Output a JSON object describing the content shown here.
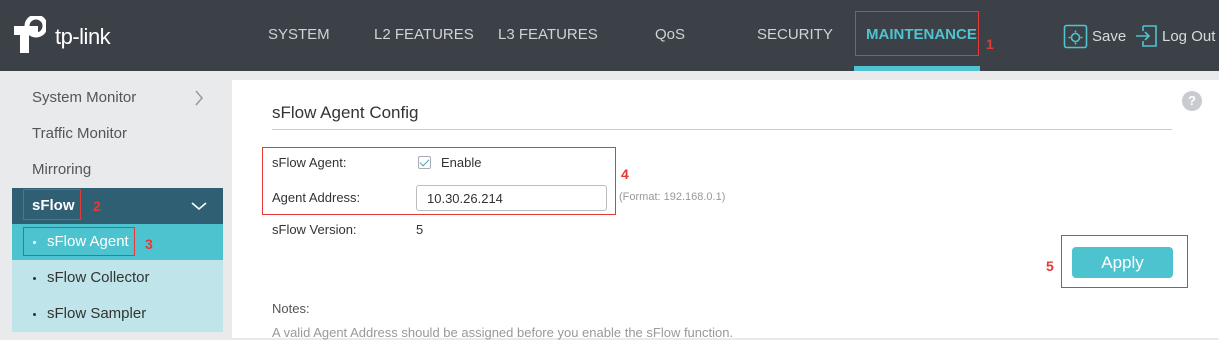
{
  "brand": {
    "logo_text": "tp-link",
    "accent": "#4fc3cf"
  },
  "nav": {
    "items": [
      {
        "label": "SYSTEM"
      },
      {
        "label": "L2 FEATURES"
      },
      {
        "label": "L3 FEATURES"
      },
      {
        "label": "QoS"
      },
      {
        "label": "SECURITY"
      },
      {
        "label": "MAINTENANCE",
        "active": true
      }
    ]
  },
  "toolbar": {
    "save_label": "Save",
    "save_icon": "gear-save-icon",
    "logout_label": "Log Out",
    "logout_icon": "logout-icon"
  },
  "sidebar": {
    "items": [
      {
        "label": "System Monitor",
        "icon": "chevron-right-icon"
      },
      {
        "label": "Traffic Monitor"
      },
      {
        "label": "Mirroring"
      },
      {
        "label": "sFlow",
        "active": true,
        "icon": "chevron-down-icon"
      }
    ],
    "sub_items": [
      {
        "label": "sFlow Agent",
        "active": true
      },
      {
        "label": "sFlow Collector"
      },
      {
        "label": "sFlow Sampler"
      }
    ]
  },
  "main": {
    "title": "sFlow Agent Config",
    "help_icon": "help-icon",
    "fields": {
      "agent_label": "sFlow Agent:",
      "agent_checkbox_label": "Enable",
      "agent_enabled": true,
      "address_label": "Agent Address:",
      "address_value": "10.30.26.214",
      "address_hint": "(Format: 192.168.0.1)",
      "version_label": "sFlow Version:",
      "version_value": "5"
    },
    "apply_label": "Apply",
    "notes_title": "Notes:",
    "notes_text": "A valid Agent Address should be assigned before you enable the sFlow function."
  },
  "annotations": [
    "1",
    "2",
    "3",
    "4",
    "5"
  ]
}
